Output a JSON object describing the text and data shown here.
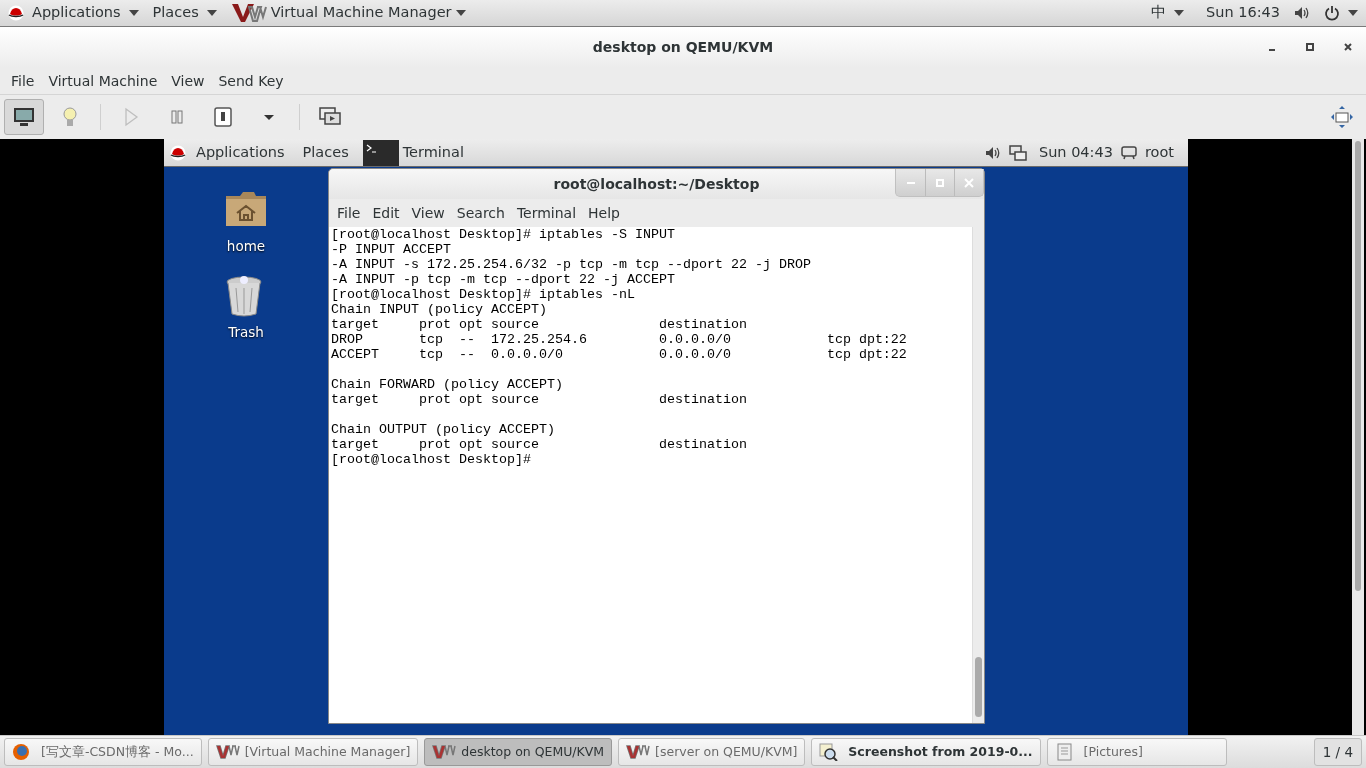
{
  "top_panel": {
    "applications": "Applications",
    "places": "Places",
    "app_name": "Virtual Machine Manager",
    "input_method": "中",
    "clock": "Sun 16:43"
  },
  "window": {
    "title": "desktop on QEMU/KVM"
  },
  "menu": [
    "File",
    "Virtual Machine",
    "View",
    "Send Key"
  ],
  "toolbar": [
    {
      "kind": "console",
      "selected": true,
      "disabled": false
    },
    {
      "kind": "details",
      "selected": false,
      "disabled": false
    },
    {
      "kind": "run",
      "selected": false,
      "disabled": true
    },
    {
      "kind": "pause",
      "selected": false,
      "disabled": false
    },
    {
      "kind": "shutdown",
      "selected": false,
      "disabled": false
    },
    {
      "kind": "dropdown",
      "selected": false,
      "disabled": false
    },
    {
      "kind": "snapshots",
      "selected": false,
      "disabled": false
    }
  ],
  "guest": {
    "panel": {
      "applications": "Applications",
      "places": "Places",
      "app_name": "Terminal",
      "clock": "Sun 04:43",
      "user": "root"
    },
    "desktop_icons": [
      {
        "kind": "home",
        "label": "home"
      },
      {
        "kind": "trash",
        "label": "Trash"
      }
    ],
    "terminal": {
      "title": "root@localhost:~/Desktop",
      "menu": [
        "File",
        "Edit",
        "View",
        "Search",
        "Terminal",
        "Help"
      ],
      "blocks": [
        [
          "[root@localhost Desktop]# iptables -S INPUT",
          "-P INPUT ACCEPT",
          "-A INPUT -s 172.25.254.6/32 -p tcp -m tcp --dport 22 -j DROP",
          "-A INPUT -p tcp -m tcp --dport 22 -j ACCEPT",
          "[root@localhost Desktop]# iptables -nL",
          "Chain INPUT (policy ACCEPT)",
          "target     prot opt source               destination         ",
          "DROP       tcp  --  172.25.254.6         0.0.0.0/0            tcp dpt:22",
          "ACCEPT     tcp  --  0.0.0.0/0            0.0.0.0/0            tcp dpt:22"
        ],
        [
          "Chain FORWARD (policy ACCEPT)",
          "target     prot opt source               destination"
        ],
        [
          "Chain OUTPUT (policy ACCEPT)",
          "target     prot opt source               destination",
          "[root@localhost Desktop]# "
        ]
      ]
    }
  },
  "taskbar": [
    {
      "kind": "browser",
      "label": "[写文章-CSDN博客 - Mo...",
      "selected": false
    },
    {
      "kind": "vm",
      "label": "[Virtual Machine Manager]",
      "selected": false
    },
    {
      "kind": "vm",
      "label": "desktop on QEMU/KVM",
      "selected": true
    },
    {
      "kind": "vm",
      "label": "[server on QEMU/KVM]",
      "selected": false
    },
    {
      "kind": "screenshot",
      "label": "Screenshot from 2019-0...",
      "selected": false
    },
    {
      "kind": "files",
      "label": "[Pictures]",
      "selected": false
    }
  ],
  "workspace": "1 / 4"
}
